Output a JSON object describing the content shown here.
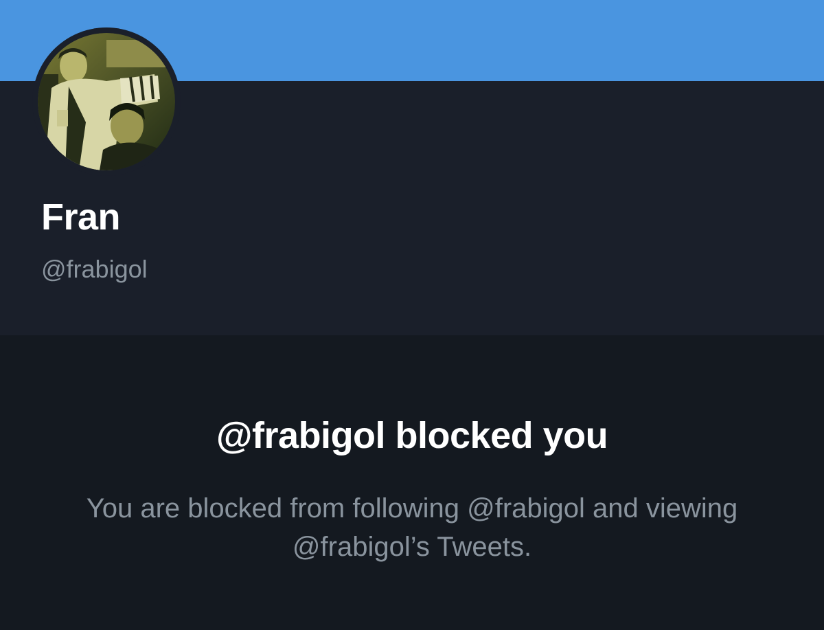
{
  "profile": {
    "display_name": "Fran",
    "handle": "@frabigol",
    "avatar_alt": "profile photo"
  },
  "blocked": {
    "title": "@frabigol blocked you",
    "description": "You are blocked from following @frabigol and viewing @frabigol’s Tweets."
  },
  "colors": {
    "banner": "#4a95e0",
    "profile_bg": "#1a1f2a",
    "blocked_bg": "#141920",
    "primary_text": "#ffffff",
    "secondary_text": "#8a949e"
  }
}
